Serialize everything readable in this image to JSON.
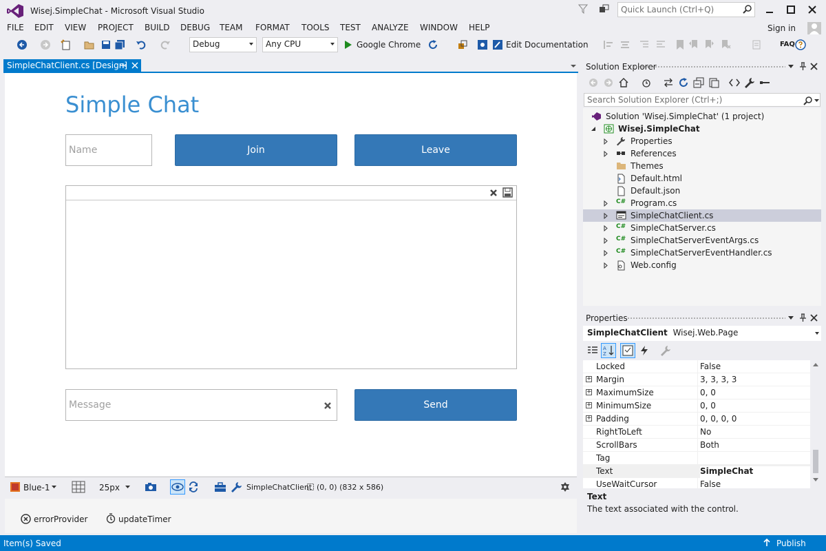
{
  "window": {
    "title": "Wisej.SimpleChat - Microsoft Visual Studio",
    "quick_launch_placeholder": "Quick Launch (Ctrl+Q)",
    "controls": [
      "minimize",
      "maximize",
      "close"
    ]
  },
  "menu": {
    "items": [
      "FILE",
      "EDIT",
      "VIEW",
      "PROJECT",
      "BUILD",
      "DEBUG",
      "TEAM",
      "FORMAT",
      "TOOLS",
      "TEST",
      "ANALYZE",
      "WINDOW",
      "HELP"
    ],
    "sign_in": "Sign in"
  },
  "toolbar": {
    "config": "Debug",
    "platform": "Any CPU",
    "run_target": "Google Chrome",
    "edit_documentation": "Edit Documentation",
    "faq": "FAQ"
  },
  "doc_tab": {
    "label": "SimpleChatClient.cs [Design]"
  },
  "designer": {
    "title": "Simple Chat",
    "name_placeholder": "Name",
    "join_label": "Join",
    "leave_label": "Leave",
    "message_placeholder": "Message",
    "send_label": "Send"
  },
  "designer_toolbar": {
    "theme": "Blue-1",
    "grid_size": "25px",
    "selected_name": "SimpleChatClient",
    "selected_info": "(0, 0) (832 x 586)"
  },
  "components": [
    "errorProvider",
    "updateTimer"
  ],
  "solution_explorer": {
    "title": "Solution Explorer",
    "search_placeholder": "Search Solution Explorer (Ctrl+;)",
    "tree": [
      {
        "label": "Solution 'Wisej.SimpleChat' (1 project)",
        "icon": "solution-icon"
      },
      {
        "label": "Wisej.SimpleChat",
        "icon": "web-project-icon",
        "bold": true
      },
      {
        "label": "Properties",
        "icon": "wrench-icon"
      },
      {
        "label": "References",
        "icon": "references-icon"
      },
      {
        "label": "Themes",
        "icon": "folder-icon"
      },
      {
        "label": "Default.html",
        "icon": "html-file-icon"
      },
      {
        "label": "Default.json",
        "icon": "json-file-icon"
      },
      {
        "label": "Program.cs",
        "icon": "csharp-file-icon"
      },
      {
        "label": "SimpleChatClient.cs",
        "icon": "form-file-icon",
        "selected": true
      },
      {
        "label": "SimpleChatServer.cs",
        "icon": "csharp-file-icon"
      },
      {
        "label": "SimpleChatServerEventArgs.cs",
        "icon": "csharp-file-icon"
      },
      {
        "label": "SimpleChatServerEventHandler.cs",
        "icon": "csharp-file-icon"
      },
      {
        "label": "Web.config",
        "icon": "config-file-icon"
      }
    ]
  },
  "properties": {
    "title": "Properties",
    "object_name": "SimpleChatClient",
    "object_type": "Wisej.Web.Page",
    "rows": [
      {
        "name": "Locked",
        "value": "False",
        "expandable": false
      },
      {
        "name": "Margin",
        "value": "3, 3, 3, 3",
        "expandable": true
      },
      {
        "name": "MaximumSize",
        "value": "0, 0",
        "expandable": true
      },
      {
        "name": "MinimumSize",
        "value": "0, 0",
        "expandable": true
      },
      {
        "name": "Padding",
        "value": "0, 0, 0, 0",
        "expandable": true
      },
      {
        "name": "RightToLeft",
        "value": "No",
        "expandable": false
      },
      {
        "name": "ScrollBars",
        "value": "Both",
        "expandable": false
      },
      {
        "name": "Tag",
        "value": "",
        "expandable": false
      },
      {
        "name": "Text",
        "value": "SimpleChat",
        "expandable": false,
        "bold": true
      },
      {
        "name": "UseWaitCursor",
        "value": "False",
        "expandable": false
      }
    ],
    "description_title": "Text",
    "description_text": "The text associated with the control."
  },
  "status": {
    "message": "Item(s) Saved",
    "publish": "Publish"
  },
  "colors": {
    "accent": "#007acc",
    "button": "#3478b7",
    "title_text": "#3a8fd1",
    "selection": "#cccedb"
  }
}
